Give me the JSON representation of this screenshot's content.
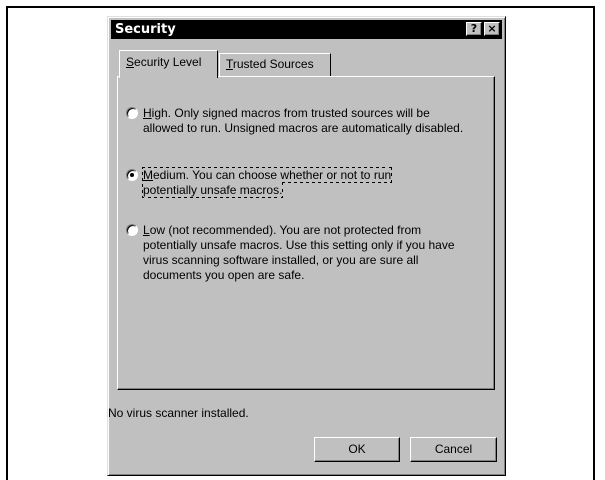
{
  "dialog": {
    "title": "Security",
    "help_glyph": "?",
    "close_glyph": "×"
  },
  "tabs": [
    {
      "label": "Security Level",
      "mnemonic": "S",
      "rest": "ecurity Level",
      "active": true
    },
    {
      "label": "Trusted Sources",
      "mnemonic": "T",
      "rest": "rusted Sources",
      "active": false
    }
  ],
  "options": [
    {
      "mnemonic": "H",
      "rest": "igh. Only signed macros from trusted sources will be allowed to run. Unsigned macros are automatically disabled.",
      "checked": false
    },
    {
      "mnemonic": "M",
      "rest": "edium. You can choose whether or not to run potentially unsafe macros.",
      "checked": true
    },
    {
      "mnemonic": "L",
      "rest": "ow (not recommended). You are not protected from potentially unsafe macros. Use this setting only if you have virus scanning software installed, or you are sure all documents you open are safe.",
      "checked": false
    }
  ],
  "status_text": "No virus scanner installed.",
  "buttons": {
    "ok": "OK",
    "cancel": "Cancel"
  }
}
